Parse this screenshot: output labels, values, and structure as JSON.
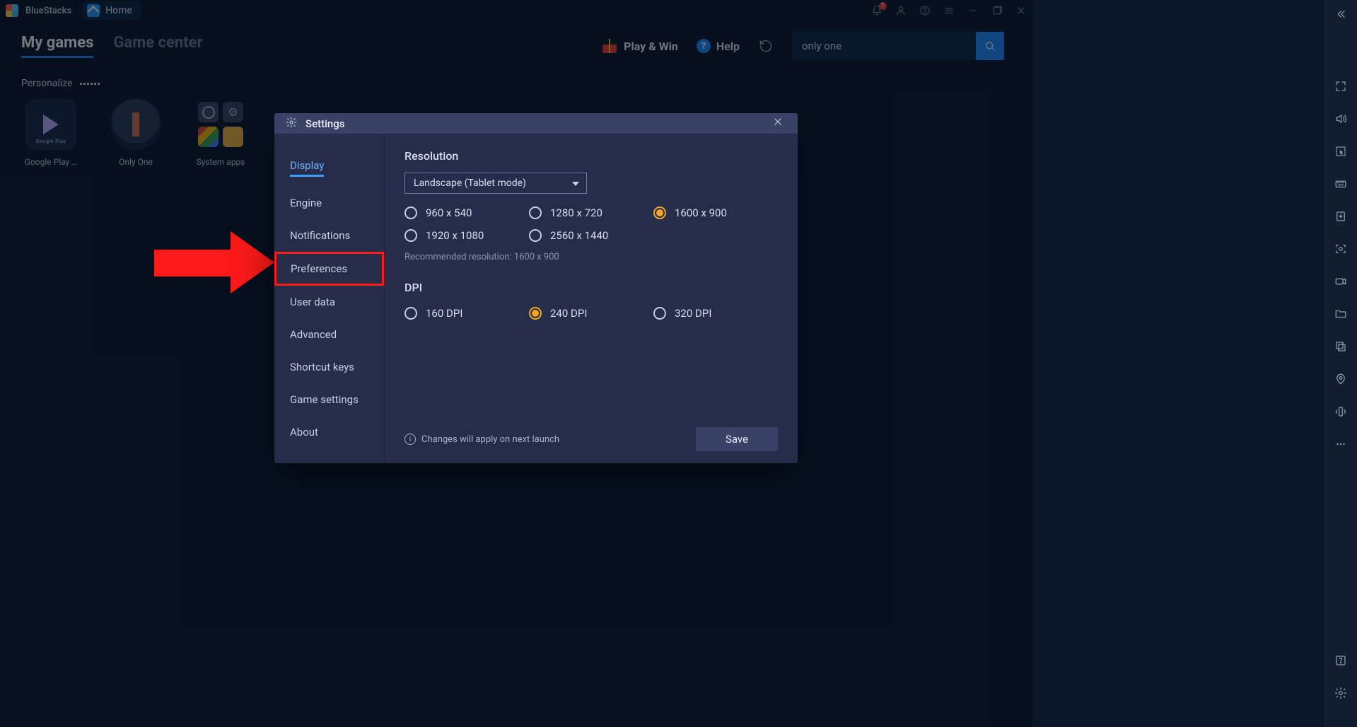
{
  "app": {
    "name": "BlueStacks"
  },
  "tabs": {
    "home_label": "Home"
  },
  "nav": {
    "my_games": "My games",
    "game_center": "Game center"
  },
  "header": {
    "play_win": "Play & Win",
    "help": "Help",
    "search_value": "only one",
    "notif_count": "1"
  },
  "personalize": {
    "label": "Personalize"
  },
  "apps": [
    {
      "label": "Google Play …",
      "sublabel": "Google Play"
    },
    {
      "label": "Only One"
    },
    {
      "label": "System apps"
    }
  ],
  "settings": {
    "title": "Settings",
    "nav": {
      "display": "Display",
      "engine": "Engine",
      "notifications": "Notifications",
      "preferences": "Preferences",
      "user_data": "User data",
      "advanced": "Advanced",
      "shortcut_keys": "Shortcut keys",
      "game_settings": "Game settings",
      "about": "About"
    },
    "resolution": {
      "title": "Resolution",
      "mode": "Landscape (Tablet mode)",
      "options": [
        "960 x 540",
        "1280 x 720",
        "1600 x 900",
        "1920 x 1080",
        "2560 x 1440"
      ],
      "selected": "1600 x 900",
      "recommended": "Recommended resolution: 1600 x 900"
    },
    "dpi": {
      "title": "DPI",
      "options": [
        "160 DPI",
        "240 DPI",
        "320 DPI"
      ],
      "selected": "240 DPI"
    },
    "footer_note": "Changes will apply on next launch",
    "save_label": "Save"
  },
  "sidebar_icons": [
    "collapse",
    "fullscreen",
    "volume",
    "cursor",
    "keyboard",
    "install",
    "camera",
    "record",
    "folder",
    "multi",
    "location",
    "shake",
    "more",
    "help",
    "gear"
  ]
}
